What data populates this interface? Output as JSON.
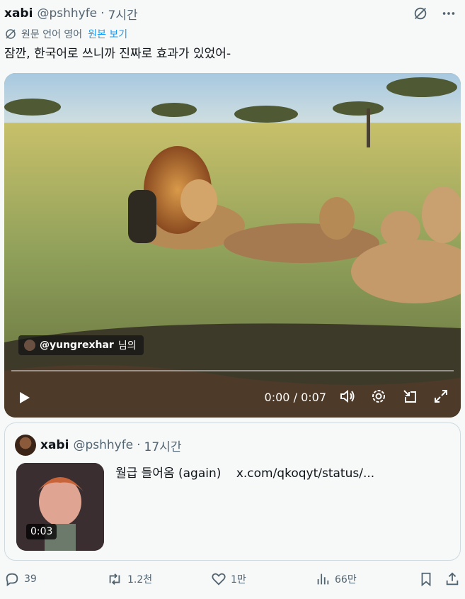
{
  "header": {
    "author_name": "xabi",
    "author_handle": "@pshhyfe",
    "separator": "·",
    "time": "7시간"
  },
  "translation": {
    "label": "원문 언어 영어",
    "show_original": "원본 보기"
  },
  "tweet_text": "잠깐, 한국어로 쓰니까 진짜로 효과가 있었어-",
  "video": {
    "credit_handle": "@yungrexhar",
    "credit_suffix": "님의",
    "time_current": "0:00",
    "time_sep": "/",
    "time_total": "0:07",
    "progress": 0
  },
  "quote": {
    "author_name": "xabi",
    "author_handle": "@pshhyfe",
    "separator": "·",
    "time": "17시간",
    "text": "월급 들어옴 (again)",
    "link": "x.com/qkoqyt/status/...",
    "thumb_duration": "0:03"
  },
  "actions": {
    "replies": "39",
    "retweets": "1.2천",
    "likes": "1만",
    "views": "66만"
  }
}
